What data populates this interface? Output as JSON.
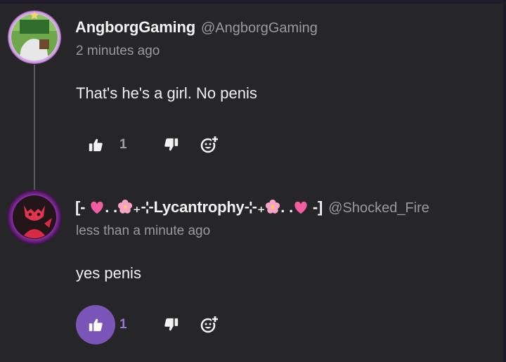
{
  "comments": [
    {
      "author": "AngborgGaming",
      "handle": "@AngborgGaming",
      "time": "2 minutes ago",
      "text": "That's he's a girl. No penis",
      "likes": "1",
      "liked": false
    },
    {
      "author_prefix": "[-",
      "author_mid_1": ". .",
      "author_core": "₊⊹Lycantrophy⊹₊",
      "author_mid_2": ". .",
      "author_suffix": "-]",
      "handle": "@Shocked_Fire",
      "time": "less than a minute ago",
      "text": "yes penis",
      "likes": "1",
      "liked": true
    }
  ],
  "icons": {
    "like": "thumbs-up-icon",
    "dislike": "thumbs-down-icon",
    "react": "add-reaction-icon",
    "heart": "pink-heart-emoji",
    "blossom": "cherry-blossom-emoji"
  },
  "colors": {
    "background": "#262628",
    "accent": "#7b56b8",
    "muted": "#9a9a9e"
  }
}
